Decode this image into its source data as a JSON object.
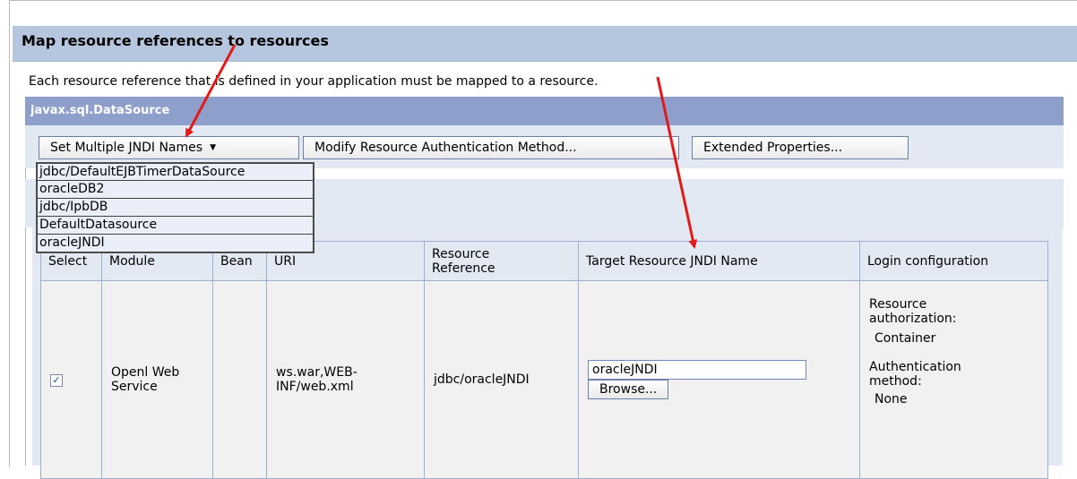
{
  "header": {
    "title": "Map resource references to resources"
  },
  "description": "Each resource reference that is defined in your application must be mapped to a resource.",
  "group": {
    "title": "javax.sql.DataSource"
  },
  "toolbar": {
    "set_jndi_label": "Set Multiple JNDI Names",
    "modify_auth_label": "Modify Resource Authentication Method...",
    "extended_props_label": "Extended Properties..."
  },
  "dropdown": {
    "items": [
      "jdbc/DefaultEJBTimerDataSource",
      "oracleDB2",
      "jdbc/IpbDB",
      "DefaultDatasource",
      "oracleJNDI"
    ]
  },
  "table": {
    "headers": [
      "Select",
      "Module",
      "Bean",
      "URI",
      "Resource Reference",
      "Target Resource JNDI Name",
      "Login configuration"
    ],
    "header_resource_ref_1": "Resource",
    "header_resource_ref_2": "Reference",
    "row": {
      "module": "Openl Web Service",
      "module_1": "Openl Web",
      "module_2": "Service",
      "bean": "",
      "uri_1": "ws.war,WEB-",
      "uri_2": "INF/web.xml",
      "resource_reference": "jdbc/oracleJNDI",
      "jndi_value": "oracleJNDI",
      "browse_label": "Browse...",
      "login": {
        "auth_label_1": "Resource",
        "auth_label_2": "authorization:",
        "auth_value": "Container",
        "method_label_1": "Authentication",
        "method_label_2": "method:",
        "method_value": "None"
      }
    }
  },
  "colors": {
    "arrow": "#e11a1a",
    "header_bg": "#b5c6de",
    "group_header": "#8e9fcc"
  }
}
